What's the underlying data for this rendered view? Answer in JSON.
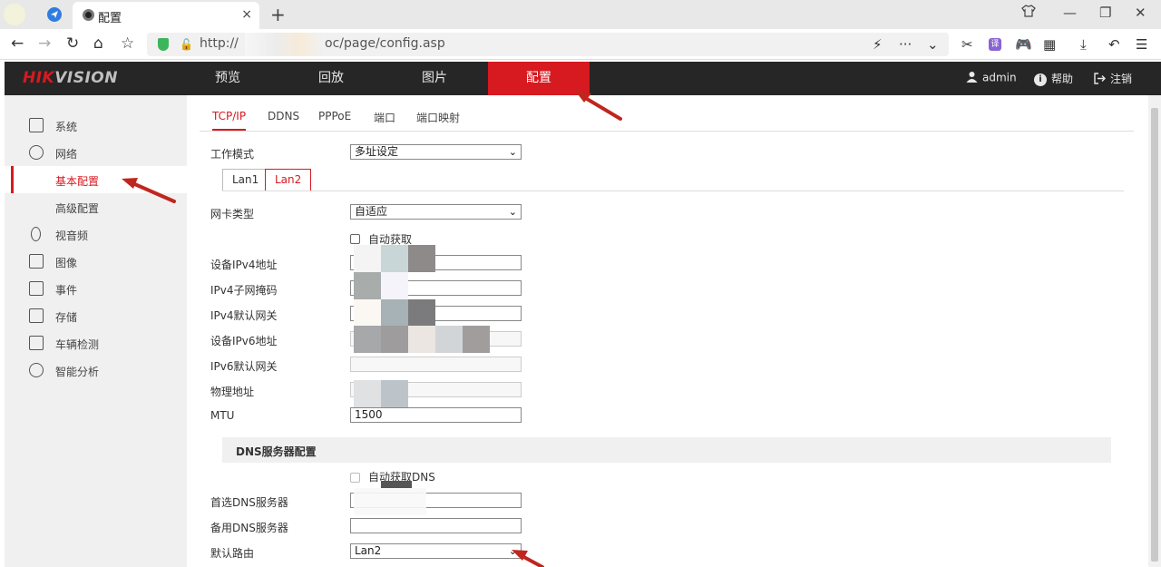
{
  "browser": {
    "tab_title": "配置",
    "tab_close": "×",
    "new_tab": "+",
    "url_prefix": "http://",
    "url_suffix": "oc/page/config.asp"
  },
  "header": {
    "logo_main": "HIK",
    "logo_tail": "VISION",
    "menu": [
      {
        "label": "预览"
      },
      {
        "label": "回放"
      },
      {
        "label": "图片"
      },
      {
        "label": "配置"
      }
    ],
    "user": "admin",
    "help": "帮助",
    "logout": "注销"
  },
  "sidebar": {
    "items": [
      {
        "label": "系统",
        "icon": "monitor-icon"
      },
      {
        "label": "网络",
        "icon": "globe-icon"
      },
      {
        "label": "基本配置",
        "icon": ""
      },
      {
        "label": "高级配置",
        "icon": ""
      },
      {
        "label": "视音频",
        "icon": "microphone-icon"
      },
      {
        "label": "图像",
        "icon": "image-icon"
      },
      {
        "label": "事件",
        "icon": "calendar-icon"
      },
      {
        "label": "存储",
        "icon": "save-icon"
      },
      {
        "label": "车辆检测",
        "icon": "vehicle-search-icon"
      },
      {
        "label": "智能分析",
        "icon": "smart-analysis-icon"
      }
    ]
  },
  "subtabs": [
    "TCP/IP",
    "DDNS",
    "PPPoE",
    "端口",
    "端口映射"
  ],
  "form": {
    "work_mode_label": "工作模式",
    "work_mode_value": "多址设定",
    "lan_tabs": [
      "Lan1",
      "Lan2"
    ],
    "nic_type_label": "网卡类型",
    "nic_type_value": "自适应",
    "auto_obtain_label": "自动获取",
    "ipv4_addr_label": "设备IPv4地址",
    "ipv4_mask_label": "IPv4子网掩码",
    "ipv4_gateway_label": "IPv4默认网关",
    "ipv6_addr_label": "设备IPv6地址",
    "ipv6_gateway_label": "IPv6默认网关",
    "mac_label": "物理地址",
    "mtu_label": "MTU",
    "mtu_value": "1500",
    "dns_section_title": "DNS服务器配置",
    "auto_dns_label": "自动获取DNS",
    "pref_dns_label": "首选DNS服务器",
    "alt_dns_label": "备用DNS服务器",
    "default_route_label": "默认路由",
    "default_route_value": "Lan2"
  },
  "colors": {
    "accent": "#d71920",
    "header_bg": "#262626",
    "annotation_arrow": "#c0261e"
  }
}
